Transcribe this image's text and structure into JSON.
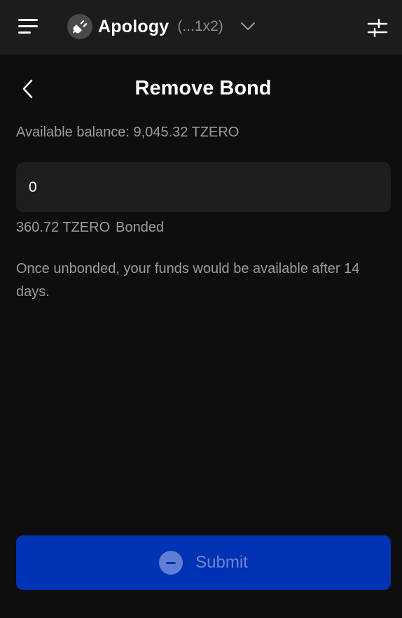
{
  "topbar": {
    "menu_icon": "hamburger-menu-icon",
    "account": {
      "avatar_icon": "plug-icon",
      "name": "Apology",
      "address": "(...1x2)",
      "chevron_icon": "chevron-down-icon"
    },
    "settings_icon": "sliders-icon"
  },
  "header": {
    "back_icon": "chevron-left-icon",
    "title": "Remove Bond"
  },
  "form": {
    "available_balance": "Available balance: 9,045.32 TZERO",
    "amount_value": "0",
    "bonded_amount": "360.72 TZERO",
    "bonded_label": "Bonded",
    "info_text": "Once unbonded, your funds would be available after 14 days."
  },
  "submit": {
    "icon": "minus-circle-icon",
    "label": "Submit"
  },
  "colors": {
    "background": "#0e0e0e",
    "topbar": "#1c1c1c",
    "input": "#1e1e1e",
    "submit": "#0032b4",
    "muted_text": "#9b9b9b"
  }
}
